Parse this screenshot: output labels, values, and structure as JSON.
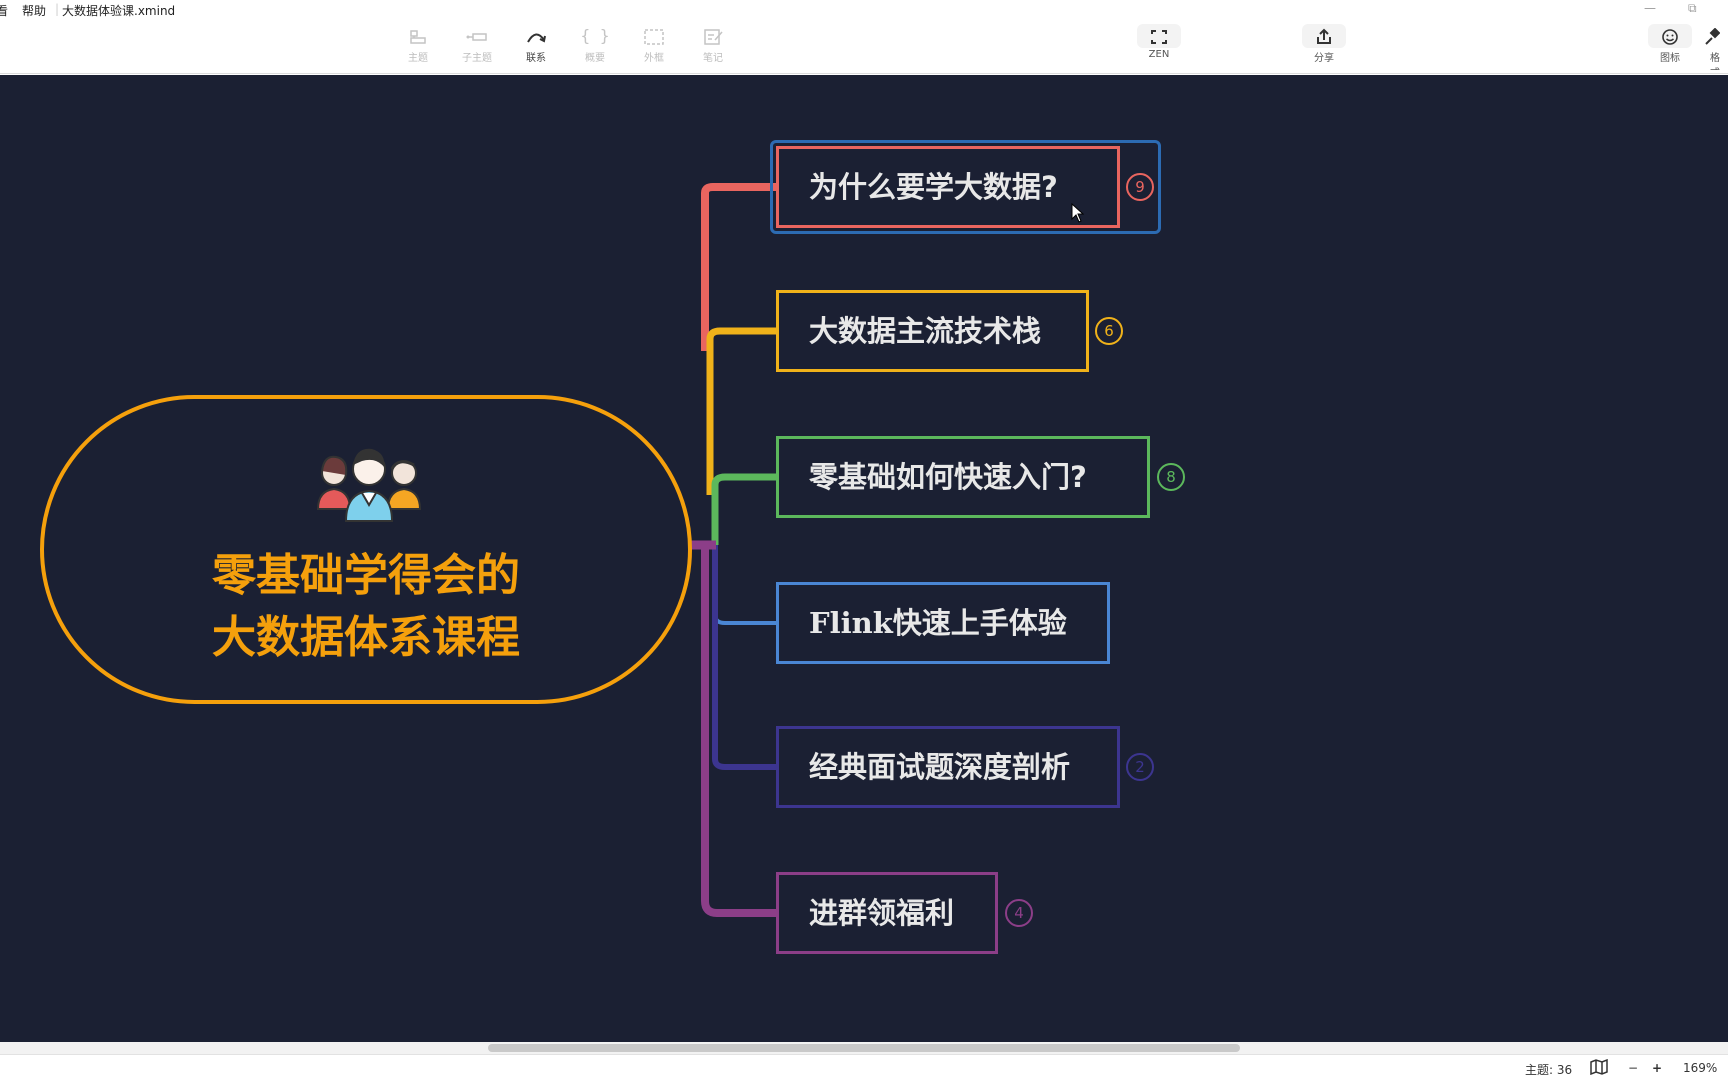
{
  "titlebar": {
    "menu_view": "看",
    "menu_help": "帮助",
    "file_name": "大数据体验课.xmind",
    "minimize_glyph": "—",
    "restore_glyph": "⧉"
  },
  "toolbar": {
    "topic": "主题",
    "subtopic": "子主题",
    "relationship": "联系",
    "summary": "概要",
    "boundary": "外框",
    "note": "笔记",
    "zen": "ZEN",
    "share": "分享",
    "icon": "图标",
    "format": "格式"
  },
  "mindmap": {
    "central": {
      "line1": "零基础学得会的",
      "line2": "大数据体系课程",
      "icon": "people-group-icon",
      "border_color": "#f5a00c"
    },
    "topics": [
      {
        "label": "为什么要学大数据?",
        "color": "#e9655f",
        "count": "9",
        "selected": true
      },
      {
        "label": "大数据主流技术栈",
        "color": "#f0b21a",
        "count": "6"
      },
      {
        "label": "零基础如何快速入门?",
        "color": "#5cb85c",
        "count": "8"
      },
      {
        "label": "Flink快速上手体验",
        "color": "#4a86d4",
        "count": null
      },
      {
        "label": "经典面试题深度剖析",
        "color": "#3c3590",
        "count": "2"
      },
      {
        "label": "进群领福利",
        "color": "#8c3e88",
        "count": "4"
      }
    ]
  },
  "statusbar": {
    "topic_count": "主题: 36",
    "zoom_minus": "−",
    "zoom_plus": "+",
    "zoom": "169%"
  },
  "colors": {
    "canvas_bg": "#1b2033",
    "selection": "#2c6bb3"
  }
}
